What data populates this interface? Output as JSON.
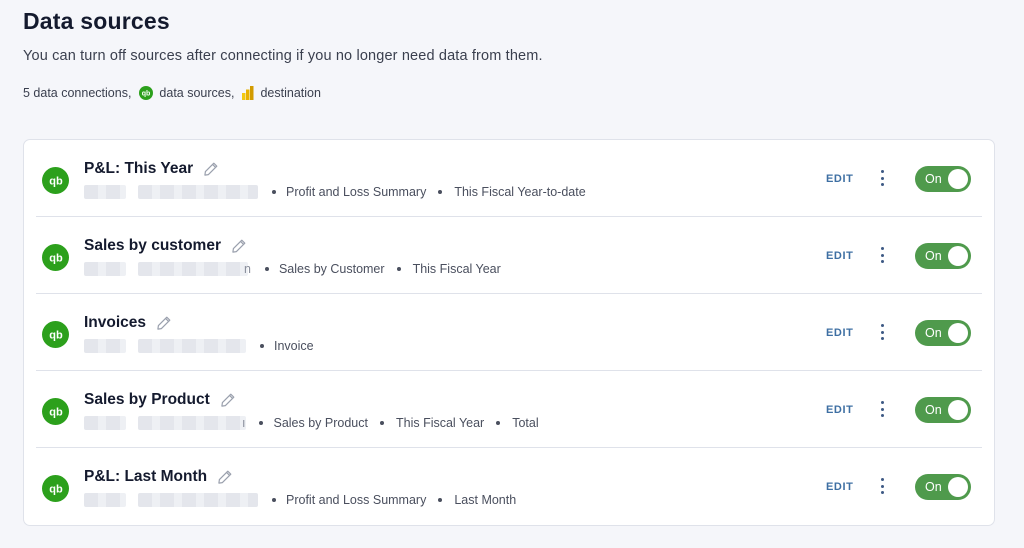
{
  "page": {
    "title": "Data sources",
    "subtitle": "You can turn off sources after connecting if you no longer need data from them.",
    "summary": {
      "connections": "5 data connections,",
      "sources": "data sources,",
      "destination": "destination"
    }
  },
  "colors": {
    "quickbooks_green": "#2ca01c",
    "toggle_on": "#4f9a4c",
    "edit_link": "#3e6fa3"
  },
  "connections": [
    {
      "name": "P&L: This Year",
      "details": [
        "Profit and Loss Summary",
        "This Fiscal Year-to-date"
      ],
      "blurred_tail": "",
      "edit_label": "EDIT",
      "toggle_label": "On",
      "enabled": true
    },
    {
      "name": "Sales by customer",
      "details": [
        "Sales by Customer",
        "This Fiscal Year"
      ],
      "blurred_tail": "n",
      "edit_label": "EDIT",
      "toggle_label": "On",
      "enabled": true
    },
    {
      "name": "Invoices",
      "details": [
        "Invoice"
      ],
      "blurred_tail": "",
      "edit_label": "EDIT",
      "toggle_label": "On",
      "enabled": true
    },
    {
      "name": "Sales by Product",
      "details": [
        "Sales by Product",
        "This Fiscal Year",
        "Total"
      ],
      "blurred_tail": "ı",
      "edit_label": "EDIT",
      "toggle_label": "On",
      "enabled": true
    },
    {
      "name": "P&L: Last Month",
      "details": [
        "Profit and Loss Summary",
        "Last Month"
      ],
      "blurred_tail": "",
      "edit_label": "EDIT",
      "toggle_label": "On",
      "enabled": true
    }
  ]
}
